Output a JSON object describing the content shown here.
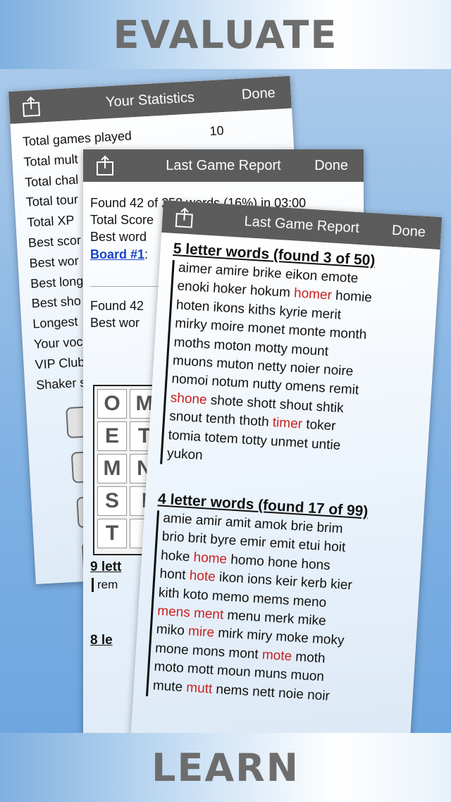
{
  "header": {
    "title": "EVALUATE"
  },
  "footer": {
    "title": "LEARN"
  },
  "stats_card": {
    "title": "Your Statistics",
    "done_label": "Done",
    "rows": [
      {
        "label": "Total games played",
        "value": "10"
      },
      {
        "label": "Total mult",
        "value": ""
      },
      {
        "label": "Total chal",
        "value": ""
      },
      {
        "label": "Total tour",
        "value": ""
      },
      {
        "label": "Total XP",
        "value": ""
      },
      {
        "label": "Best scor",
        "value": ""
      },
      {
        "label": "Best wor",
        "value": ""
      },
      {
        "label": "Best long",
        "value": ""
      },
      {
        "label": "Best sho",
        "value": ""
      },
      {
        "label": "Longest",
        "value": ""
      },
      {
        "label": "Your voc",
        "value": ""
      },
      {
        "label": "VIP Club",
        "value": ""
      },
      {
        "label": "Shaker s",
        "value": ""
      }
    ]
  },
  "report_back": {
    "title": "Last Game Report",
    "done_label": "Done",
    "summary_line": "Found 42 of 258 words (16%) in 03:00",
    "score_label": "Total Score",
    "best_label": "Best word",
    "board_link": "Board #1",
    "board_suffix": ":",
    "found_label": "Found 42",
    "best_word_label": "Best wor",
    "grid_letters": [
      "O",
      "M",
      "E",
      "T",
      "M",
      "N",
      "S",
      "I",
      "T",
      ""
    ],
    "nine_heading": "9 lett",
    "nine_words": "rem",
    "eight_heading": "8 le"
  },
  "report_front": {
    "title": "Last Game Report",
    "done_label": "Done",
    "section5": {
      "heading": "5 letter words (found 3 of 50)",
      "lines": [
        [
          {
            "w": "aimer amire brike eikon emote",
            "f": false
          }
        ],
        [
          {
            "w": "enoki hoker hokum ",
            "f": false
          },
          {
            "w": "homer",
            "f": true
          },
          {
            "w": " homie",
            "f": false
          }
        ],
        [
          {
            "w": "hoten ikons kiths kyrie merit",
            "f": false
          }
        ],
        [
          {
            "w": "mirky moire monet monte month",
            "f": false
          }
        ],
        [
          {
            "w": "moths moton motty mount",
            "f": false
          }
        ],
        [
          {
            "w": "muons muton netty noier noire",
            "f": false
          }
        ],
        [
          {
            "w": "nomoi notum nutty omens remit",
            "f": false
          }
        ],
        [
          {
            "w": "shone",
            "f": true
          },
          {
            "w": " shote shott shout shtik",
            "f": false
          }
        ],
        [
          {
            "w": "snout tenth thoth ",
            "f": false
          },
          {
            "w": "timer",
            "f": true
          },
          {
            "w": " toker",
            "f": false
          }
        ],
        [
          {
            "w": "tomia totem totty unmet untie",
            "f": false
          }
        ],
        [
          {
            "w": "yukon",
            "f": false
          }
        ]
      ]
    },
    "section4": {
      "heading": "4 letter words (found 17 of 99)",
      "lines": [
        [
          {
            "w": "amie amir amit amok brie brim",
            "f": false
          }
        ],
        [
          {
            "w": "brio brit byre emir emit etui hoit",
            "f": false
          }
        ],
        [
          {
            "w": "hoke ",
            "f": false
          },
          {
            "w": "home",
            "f": true
          },
          {
            "w": " homo hone hons",
            "f": false
          }
        ],
        [
          {
            "w": "hont ",
            "f": false
          },
          {
            "w": "hote",
            "f": true
          },
          {
            "w": " ikon ions keir kerb kier",
            "f": false
          }
        ],
        [
          {
            "w": "kith koto memo mems meno",
            "f": false
          }
        ],
        [
          {
            "w": "mens ment",
            "f": true
          },
          {
            "w": " menu merk mike",
            "f": false
          }
        ],
        [
          {
            "w": "miko ",
            "f": false
          },
          {
            "w": "mire",
            "f": true
          },
          {
            "w": " mirk miry moke moky",
            "f": false
          }
        ],
        [
          {
            "w": "mone mons mont ",
            "f": false
          },
          {
            "w": "mote",
            "f": true
          },
          {
            "w": " moth",
            "f": false
          }
        ],
        [
          {
            "w": "moto mott moun muns muon",
            "f": false
          }
        ],
        [
          {
            "w": "mute ",
            "f": false
          },
          {
            "w": "mutt",
            "f": true
          },
          {
            "w": " nems nett noie noir",
            "f": false
          }
        ]
      ]
    }
  },
  "colors": {
    "found_word": "#c8201f",
    "navbar": "#5c5c5c",
    "link": "#1844c8"
  }
}
